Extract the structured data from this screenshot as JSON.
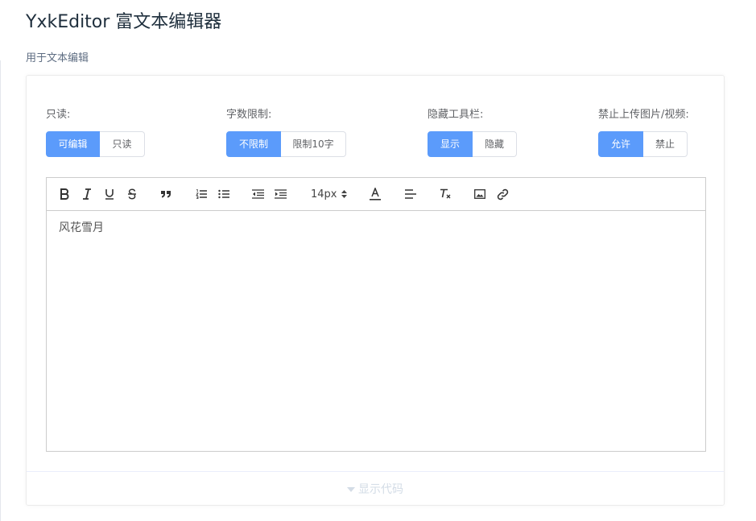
{
  "page": {
    "title": "YxkEditor 富文本编辑器",
    "description": "用于文本编辑"
  },
  "options": [
    {
      "label": "只读:",
      "buttons": [
        "可编辑",
        "只读"
      ],
      "selected": "可编辑"
    },
    {
      "label": "字数限制:",
      "buttons": [
        "不限制",
        "限制10字"
      ],
      "selected": "不限制"
    },
    {
      "label": "隐藏工具栏:",
      "buttons": [
        "显示",
        "隐藏"
      ],
      "selected": "显示"
    },
    {
      "label": "禁止上传图片/视频:",
      "buttons": [
        "允许",
        "禁止"
      ],
      "selected": "允许"
    }
  ],
  "toolbar": {
    "font_size": "14px",
    "icons": [
      "bold-icon",
      "italic-icon",
      "underline-icon",
      "strikethrough-icon",
      "blockquote-icon",
      "ordered-list-icon",
      "bullet-list-icon",
      "outdent-icon",
      "indent-icon",
      "font-size-picker",
      "font-color-icon",
      "align-icon",
      "clear-format-icon",
      "image-icon",
      "link-icon"
    ]
  },
  "editor": {
    "content": "风花雪月"
  },
  "code_toggle": {
    "label": "显示代码"
  },
  "colors": {
    "primary": "#5b9bfb",
    "border": "#dcdfe6",
    "toggle_text": "#d3dce6"
  }
}
